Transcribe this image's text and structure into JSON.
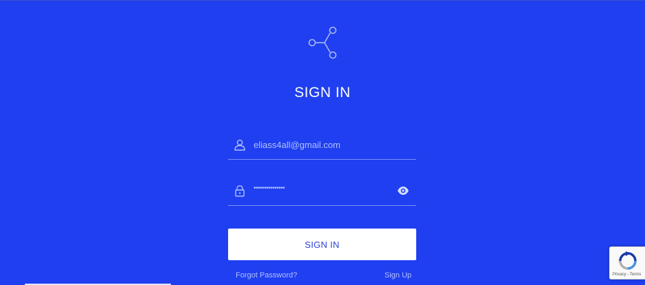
{
  "page": {
    "title": "SIGN IN"
  },
  "logo": {
    "icon": "share-nodes-icon"
  },
  "form": {
    "email": {
      "icon": "user-icon",
      "value": "eliass4all@gmail.com"
    },
    "password": {
      "icon": "lock-icon",
      "masked_value": "•••••••••••••••",
      "toggle_icon": "eye-icon"
    },
    "submit_label": "SIGN IN",
    "forgot_password_label": "Forgot Password?",
    "sign_up_label": "Sign Up"
  },
  "recaptcha": {
    "icon": "recaptcha-icon",
    "links_text": "Privacy - Terms"
  },
  "colors": {
    "background": "#1f3ff0",
    "button_bg": "#ffffff",
    "button_text": "#2a42d8",
    "muted_text": "#b3c1ff"
  }
}
